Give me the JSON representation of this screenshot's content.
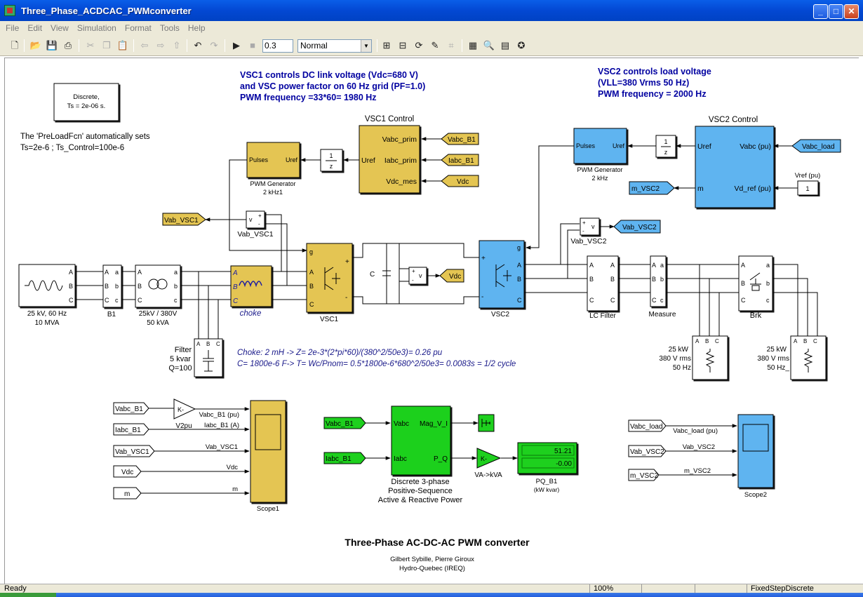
{
  "window": {
    "title": "Three_Phase_ACDCAC_PWMconverter",
    "btn_min": "_",
    "btn_max": "□",
    "btn_close": "✕"
  },
  "menu": [
    "File",
    "Edit",
    "View",
    "Simulation",
    "Format",
    "Tools",
    "Help"
  ],
  "toolbar": {
    "stop_time": "0.3",
    "sim_mode": "Normal"
  },
  "notes": {
    "vsc1_line1": "VSC1 controls DC link voltage (Vdc=680 V)",
    "vsc1_line2": "and VSC power factor on 60 Hz grid (PF=1.0)",
    "vsc1_line3": "PWM frequency =33*60= 1980 Hz",
    "vsc2_line1": "VSC2 controls  load voltage",
    "vsc2_line2": "(VLL=380 Vrms 50 Hz)",
    "vsc2_line3": "PWM frequency = 2000 Hz",
    "preload_line1": "The 'PreLoadFcn' automatically sets",
    "preload_line2": "Ts=2e-6 ;  Ts_Control=100e-6",
    "choke_note1": "Choke: 2 mH  -> Z= 2e-3*(2*pi*60)/(380^2/50e3)= 0.26 pu",
    "choke_note2": "C= 1800e-6  F-> T= Wc/Pnom= 0.5*1800e-6*680^2/50e3= 0.0083s = 1/2 cycle",
    "main_title": "Three-Phase AC-DC-AC  PWM converter",
    "author1": "Gilbert Sybille, Pierre Giroux",
    "author2": "Hydro-Quebec (IREQ)"
  },
  "powergui": {
    "line1": "Discrete,",
    "line2": "Ts = 2e-06 s."
  },
  "blocks": {
    "vsc1_control": {
      "title": "VSC1 Control",
      "p1": "Vabc_prim",
      "p2": "Iabc_prim",
      "p3": "Vdc_mes",
      "out": "Uref"
    },
    "vsc2_control": {
      "title": "VSC2 Control",
      "uref": "Uref",
      "m": "m",
      "vabc": "Vabc (pu)",
      "vdref": "Vd_ref (pu)"
    },
    "pwm1": {
      "pulses": "Pulses",
      "uref": "Uref",
      "label1": "PWM Generator",
      "label2": "2 kHz1"
    },
    "pwm2": {
      "pulses": "Pulses",
      "uref": "Uref",
      "label1": "PWM Generator",
      "label2": "2 kHz"
    },
    "delay1": {
      "num": "1",
      "den": "z"
    },
    "delay2": {
      "num": "1",
      "den": "z"
    },
    "source": {
      "label1": "25 kV, 60 Hz",
      "label2": "10 MVA"
    },
    "b1": {
      "label": "B1"
    },
    "transformer": {
      "label1": "25kV / 380V",
      "label2": "50 kVA"
    },
    "choke": {
      "label": "choke"
    },
    "vsc1": {
      "label": "VSC1"
    },
    "vsc2": {
      "label": "VSC2"
    },
    "cap": {
      "label": "C"
    },
    "lcfilter": {
      "label": "LC Filter"
    },
    "measure": {
      "label": "Measure"
    },
    "brk": {
      "label": "Brk"
    },
    "filter": {
      "label1": "Filter",
      "label2": "5 kvar",
      "label3": "Q=100"
    },
    "load1": {
      "l1": "25 kW",
      "l2": "380 V rms",
      "l3": "50 Hz"
    },
    "load2": {
      "l1": "25 kW",
      "l2": "380 V rms",
      "l3": "50 Hz_"
    },
    "vab_vsc1_meas": {
      "label": "Vab_VSC1"
    },
    "vab_vsc2_meas": {
      "label": "Vab_VSC2"
    },
    "vref": {
      "label": "Vref (pu)",
      "value": "1"
    },
    "pq": {
      "label1": "Discrete 3-phase",
      "label2": "Positive-Sequence",
      "label3": "Active & Reactive Power",
      "in1": "Vabc",
      "in2": "Iabc",
      "out1": "Mag_V_I",
      "out2": "P_Q"
    },
    "pq_display": {
      "label1": "PQ_B1",
      "label2": "(kW kvar)",
      "v1": "51.21",
      "v2": "-0.00"
    },
    "gain_v2pu": {
      "text": "K-",
      "label": "V2pu"
    },
    "gain_va": {
      "text": "K-",
      "label": "VA->kVA"
    },
    "scope1": {
      "label": "Scope1"
    },
    "scope2": {
      "label": "Scope2"
    }
  },
  "tags": {
    "vabc_b1": "Vabc_B1",
    "iabc_b1": "Iabc_B1",
    "vdc": "Vdc",
    "vabc_load": "Vabc_load",
    "m_vsc2": "m_VSC2",
    "vab_vsc1": "Vab_VSC1",
    "vab_vsc2": "Vab_VSC2",
    "m": "m",
    "vab_vsc1_from": "Vab_VSC1"
  },
  "scope_signals": {
    "s1_1": "Vabc_B1 (pu)",
    "s1_2": "Iabc_B1 (A)",
    "s1_3": "Vab_VSC1",
    "s1_4": "Vdc",
    "s1_5": "m",
    "s2_1": "Vabc_load (pu)",
    "s2_2": "Vab_VSC2",
    "s2_3": "m_VSC2"
  },
  "status": {
    "left": "Ready",
    "zoom": "100%",
    "solver": "FixedStepDiscrete"
  },
  "colors": {
    "yellow": "#e4c552",
    "blue": "#5fb4f0",
    "green": "#1ed01e",
    "note": "#0000a0"
  }
}
